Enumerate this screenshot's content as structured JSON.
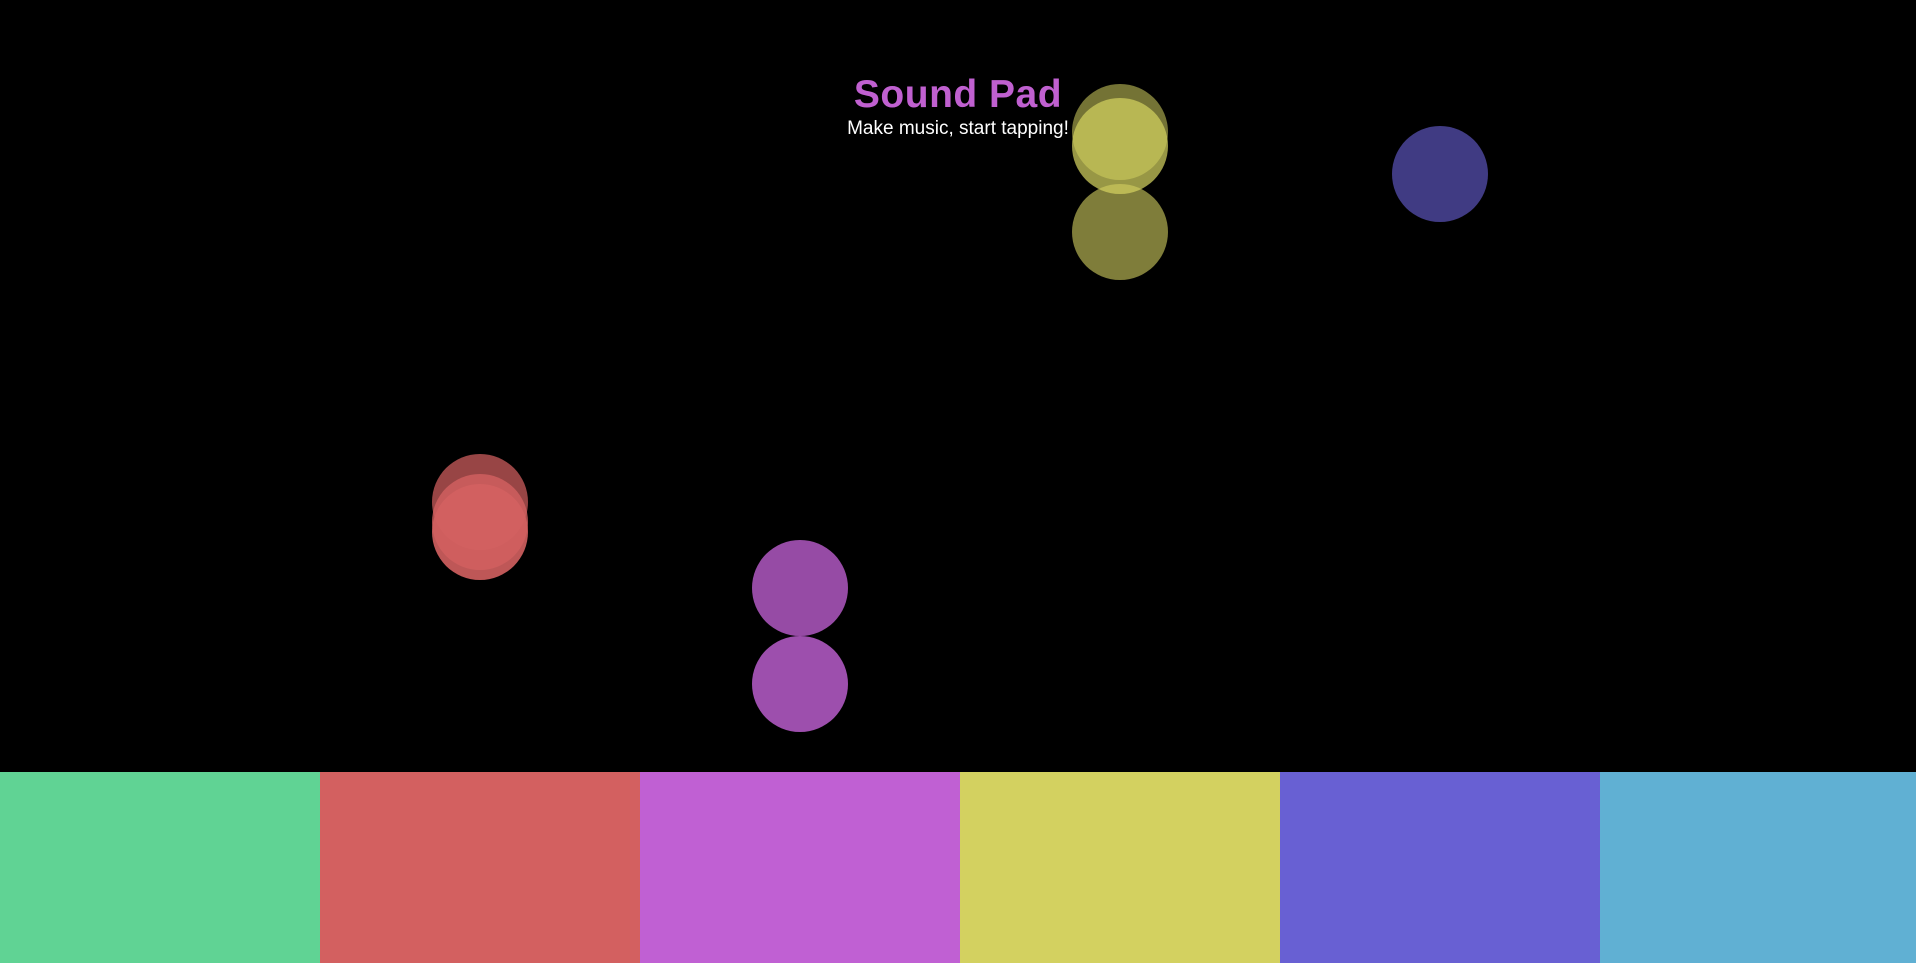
{
  "header": {
    "title": "Sound Pad",
    "subtitle": "Make music, start tapping!"
  },
  "colors": {
    "background": "#000000",
    "title": "#c060d0",
    "subtitle": "#ffffff"
  },
  "pads": [
    {
      "name": "pad-1",
      "color": "#60d394"
    },
    {
      "name": "pad-2",
      "color": "#d36060"
    },
    {
      "name": "pad-3",
      "color": "#c060d3"
    },
    {
      "name": "pad-4",
      "color": "#d3d160"
    },
    {
      "name": "pad-5",
      "color": "#6860d3"
    },
    {
      "name": "pad-6",
      "color": "#60b0d3"
    }
  ]
}
